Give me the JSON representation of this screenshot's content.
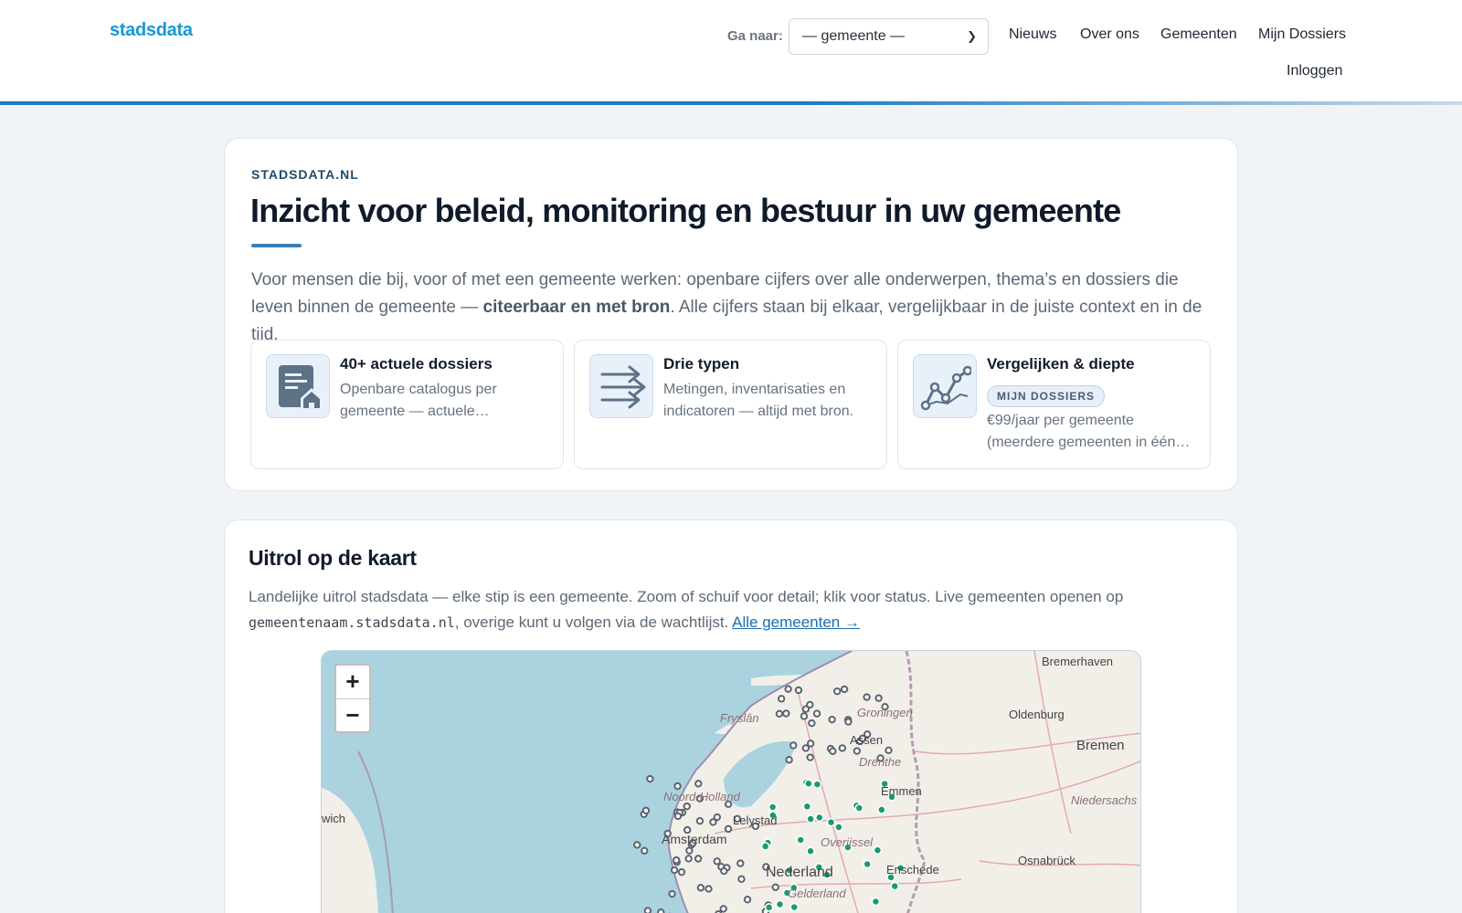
{
  "header": {
    "logo": "stadsdata",
    "goto_label": "Ga naar:",
    "goto_value": "— gemeente —",
    "nav": [
      "Nieuws",
      "Over ons",
      "Gemeenten",
      "Mijn Dossiers"
    ],
    "login": "Inloggen"
  },
  "hero": {
    "eyebrow": "STADSDATA.NL",
    "title": "Inzicht voor beleid, monitoring en bestuur in uw gemeente",
    "lead_before": "Voor mensen die bij, voor of met een gemeente werken: openbare cijfers over alle onderwerpen, thema’s en dossiers die leven binnen de gemeente — ",
    "lead_bold": "citeerbaar en met bron",
    "lead_after": ". Alle cijfers staan bij elkaar, vergelijkbaar in de juiste context en in de tijd.",
    "features": [
      {
        "title": "40+ actuele dossiers",
        "text": "Openbare catalogus per gemeente — actuele…",
        "icon": "dossier-house-icon"
      },
      {
        "title": "Drie typen",
        "text": "Metingen, inventarisaties en indicatoren — altijd met bron.",
        "icon": "arrows-icon"
      },
      {
        "title": "Vergelijken & diepte",
        "badge": "MIJN DOSSIERS",
        "text": "€99/jaar per gemeente (meerdere gemeenten in één…",
        "icon": "line-chart-icon"
      }
    ]
  },
  "map_section": {
    "title": "Uitrol op de kaart",
    "desc_before": "Landelijke uitrol stadsdata — elke stip is een gemeente. Zoom of schuif voor detail; klik voor status. Live gemeenten openen op ",
    "desc_code": "gemeentenaam.stadsdata.nl",
    "desc_after": ", overige kunt u volgen via de wachtlijst. ",
    "desc_link": "Alle gemeenten →",
    "zoom_in": "+",
    "zoom_out": "−",
    "labels": [
      "Bremerhaven",
      "Oldenburg",
      "Bremen",
      "Niedersachs",
      "Osnabrück",
      "Groningen",
      "Assen",
      "Drenthe",
      "Emmen",
      "Lelystad",
      "Amsterdam",
      "Noord-Holland",
      "Overijssel",
      "Enschede",
      "Gelderland",
      "Nederland",
      "Fryslân",
      "wich"
    ],
    "colors": {
      "water": "#aad3df",
      "land": "#f2efe9",
      "live_dot": "#1a9a73",
      "other_dot": "#5c6470"
    }
  }
}
